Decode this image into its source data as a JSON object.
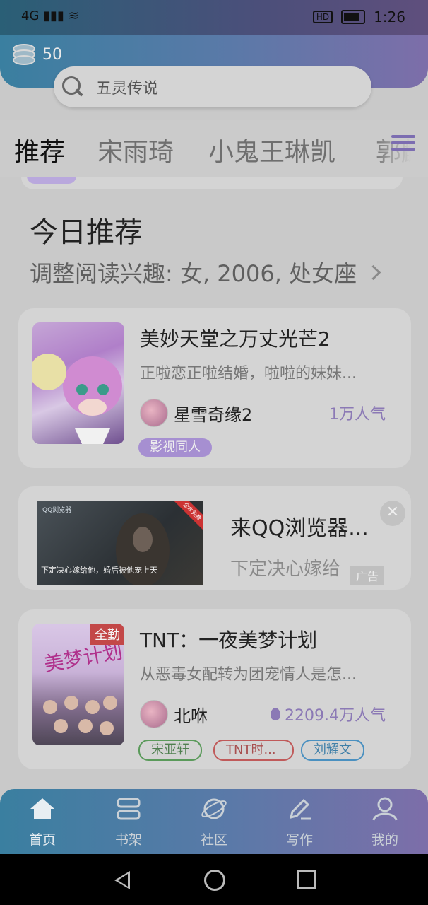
{
  "status_bar": {
    "signal": "4G",
    "time": "1:26",
    "hd_label": "HD"
  },
  "header": {
    "coins": "50",
    "search_placeholder": "五灵传说"
  },
  "tabs": [
    "推荐",
    "宋雨琦",
    "小鬼王琳凯",
    "郭麟"
  ],
  "section": {
    "title": "今日推荐",
    "subtitle": "调整阅读兴趣: 女, 2006, 处女座"
  },
  "cards": [
    {
      "title": "美妙天堂之万丈光芒2",
      "desc": "正啦恋正啦结婚，啦啦的妹妹...",
      "author": "星雪奇缘2",
      "popularity": "1万人气",
      "tags": [
        "影视同人"
      ]
    },
    {
      "title": "TNT：一夜美梦计划",
      "desc": "从恶毒女配转为团宠情人是怎...",
      "author": "北咻",
      "popularity": "2209.4万人气",
      "badge": "全勤",
      "tags": [
        "宋亚轩",
        "TNT时...",
        "刘耀文"
      ]
    }
  ],
  "ad": {
    "title": "来QQ浏览器...",
    "desc": "下定决心嫁给",
    "badge": "广告",
    "image_caption": "下定决心嫁给他，婚后被他宠上天",
    "image_logo": "QQ浏览器",
    "image_corner": "全本免费"
  },
  "bottom_nav": [
    "首页",
    "书架",
    "社区",
    "写作",
    "我的"
  ],
  "colors": {
    "accent": "#8b79b5",
    "tag_green": "#5a9a5a",
    "tag_red": "#c05a5a",
    "tag_blue": "#4a90c0"
  }
}
